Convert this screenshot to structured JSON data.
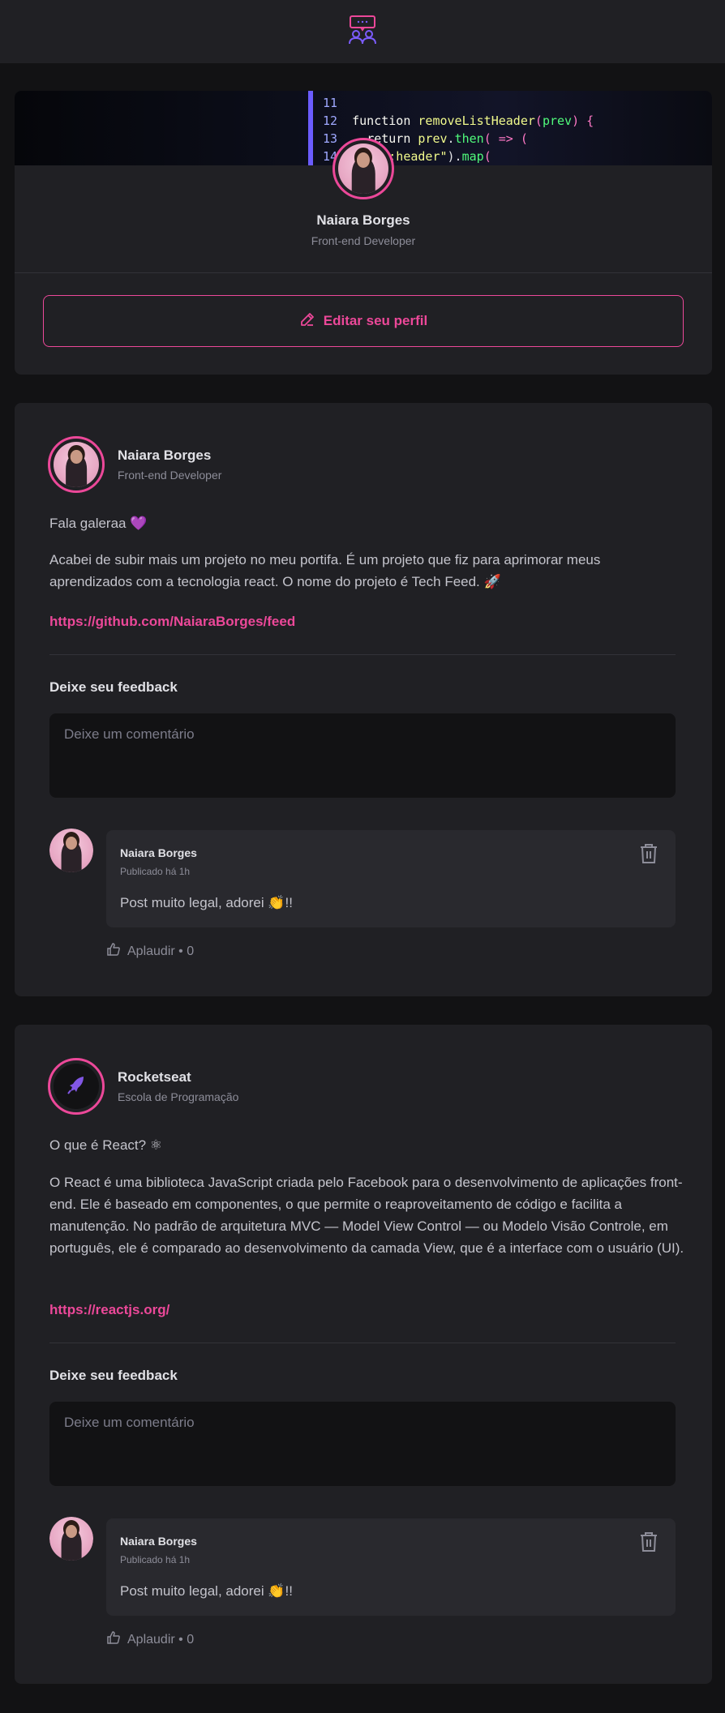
{
  "header": {
    "logo_icon": "chat-users-logo-icon"
  },
  "profile": {
    "name": "Naiara Borges",
    "role": "Front-end Developer",
    "edit_label": "Editar seu perfil"
  },
  "posts": [
    {
      "author": {
        "name": "Naiara Borges",
        "role": "Front-end Developer"
      },
      "paragraphs": [
        "Fala galeraa 💜",
        "Acabei de subir mais um projeto no meu portifa. É um projeto que fiz para aprimorar meus aprendizados com a tecnologia react. O nome do projeto é Tech Feed. 🚀"
      ],
      "link": "https://github.com/NaiaraBorges/feed",
      "feedback_title": "Deixe seu feedback",
      "comment_placeholder": "Deixe um comentário",
      "comments": [
        {
          "author": "Naiara Borges",
          "time": "Publicado há 1h",
          "text": "Post muito legal, adorei 👏!!",
          "applaud": "Aplaudir • 0"
        }
      ]
    },
    {
      "author": {
        "name": "Rocketseat",
        "role": "Escola de Programação"
      },
      "paragraphs": [
        "O que é React? ⚛",
        "O React é uma biblioteca JavaScript criada pelo Facebook para o desenvolvimento de aplicações front-end. Ele é baseado em componentes, o que permite o reaproveitamento de código e facilita a manutenção. No padrão de arquitetura MVC — Model View Control — ou Modelo Visão Controle, em português, ele é comparado ao desenvolvimento da camada View, que é a interface com o usuário (UI)."
      ],
      "link": "https://reactjs.org/",
      "feedback_title": "Deixe seu feedback",
      "comment_placeholder": "Deixe um comentário",
      "comments": [
        {
          "author": "Naiara Borges",
          "time": "Publicado há 1h",
          "text": "Post muito legal, adorei 👏!!",
          "applaud": "Aplaudir • 0"
        }
      ]
    }
  ],
  "colors": {
    "accent": "#ec4899",
    "background": "#121214",
    "card": "#202024"
  }
}
